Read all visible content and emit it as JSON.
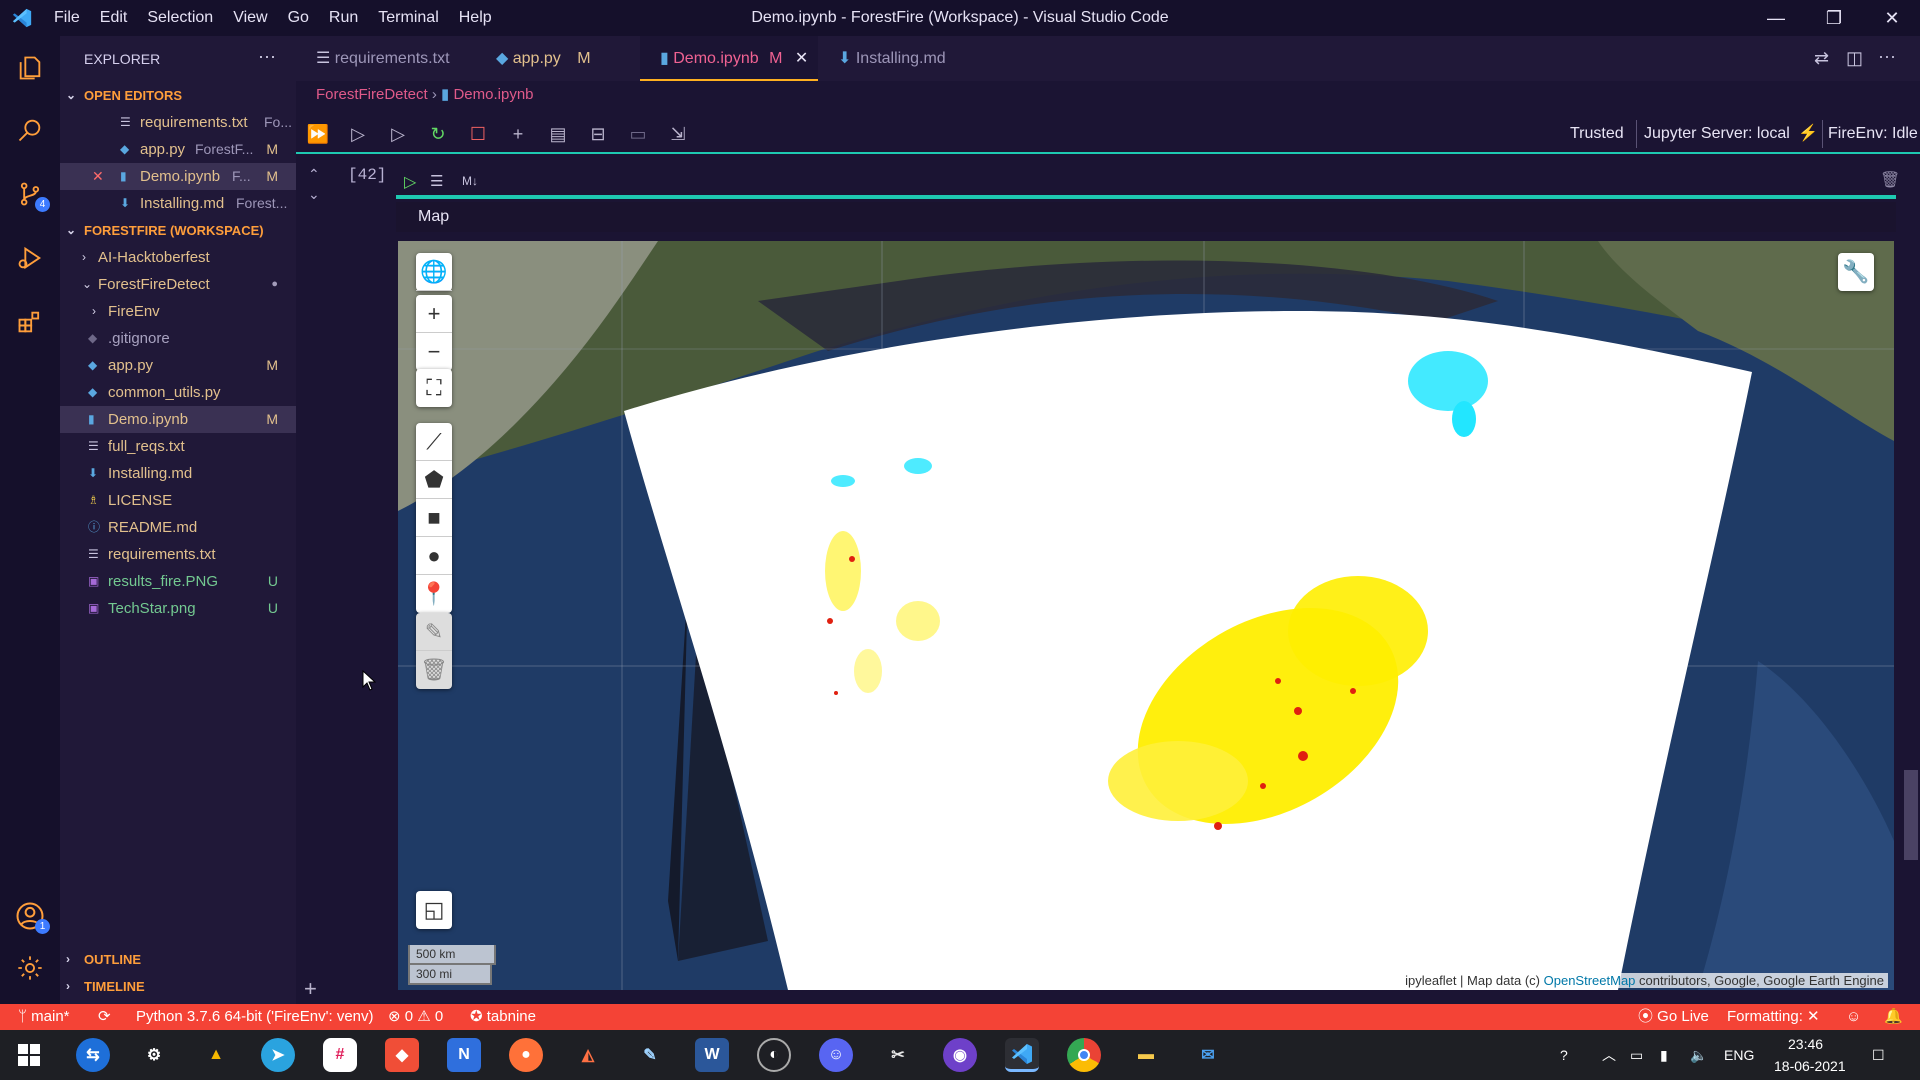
{
  "app": {
    "window_title": "Demo.ipynb - ForestFire (Workspace) - Visual Studio Code",
    "menu": [
      "File",
      "Edit",
      "Selection",
      "View",
      "Go",
      "Run",
      "Terminal",
      "Help"
    ]
  },
  "activity_bar": {
    "icons": [
      "files-icon",
      "search-icon",
      "source-control-icon",
      "run-debug-icon",
      "extensions-icon",
      "account-icon",
      "settings-gear-icon"
    ],
    "scm_badge": "4",
    "account_badge": "1"
  },
  "sidebar": {
    "title": "EXPLORER",
    "open_editors_title": "OPEN EDITORS",
    "open_editors": [
      {
        "name": "requirements.txt",
        "desc": "Fo...",
        "status": ""
      },
      {
        "name": "app.py",
        "desc": "ForestF...",
        "status": "M"
      },
      {
        "name": "Demo.ipynb",
        "desc": "F...",
        "status": "M"
      },
      {
        "name": "Installing.md",
        "desc": "Forest...",
        "status": ""
      }
    ],
    "workspace_title": "FORESTFIRE (WORKSPACE)",
    "tree": [
      {
        "name": "AI-Hacktoberfest",
        "status": ""
      },
      {
        "name": "ForestFireDetect",
        "status": "●"
      },
      {
        "name": "FireEnv",
        "status": ""
      },
      {
        "name": ".gitignore",
        "status": ""
      },
      {
        "name": "app.py",
        "status": "M"
      },
      {
        "name": "common_utils.py",
        "status": ""
      },
      {
        "name": "Demo.ipynb",
        "status": "M"
      },
      {
        "name": "full_reqs.txt",
        "status": ""
      },
      {
        "name": "Installing.md",
        "status": ""
      },
      {
        "name": "LICENSE",
        "status": ""
      },
      {
        "name": "README.md",
        "status": ""
      },
      {
        "name": "requirements.txt",
        "status": ""
      },
      {
        "name": "results_fire.PNG",
        "status": "U"
      },
      {
        "name": "TechStar.png",
        "status": "U"
      }
    ],
    "outline_title": "OUTLINE",
    "timeline_title": "TIMELINE"
  },
  "tabs": [
    {
      "name": "requirements.txt",
      "status": ""
    },
    {
      "name": "app.py",
      "status": "M"
    },
    {
      "name": "Demo.ipynb",
      "status": "M"
    },
    {
      "name": "Installing.md",
      "status": ""
    }
  ],
  "breadcrumb": {
    "folder": "ForestFireDetect",
    "file": "Demo.ipynb"
  },
  "notebook": {
    "trusted": "Trusted",
    "server": "Jupyter Server: local",
    "kernel": "FireEnv: Idle",
    "execution_count": "[42]",
    "cell_type": "M↓",
    "output_label": "Map"
  },
  "map": {
    "scale_km": "500 km",
    "scale_mi": "300 mi",
    "attribution_prefix": "ipyleaflet | Map data (c) ",
    "attribution_link": "OpenStreetMap",
    "attribution_suffix": " contributors, Google, Google Earth Engine"
  },
  "statusbar": {
    "branch": "main*",
    "python": "Python 3.7.6 64-bit ('FireEnv': venv)",
    "errors": "0",
    "warnings": "0",
    "tabnine": "tabnine",
    "golive": "Go Live",
    "formatting": "Formatting: ✕"
  },
  "taskbar": {
    "lang": "ENG",
    "time": "23:46",
    "date": "18-06-2021"
  },
  "colors": {
    "accent": "#f44336",
    "tab_active": "#f06292",
    "section": "#ff9e3b",
    "modified": "#e2c08d",
    "untracked": "#73c991",
    "teal": "#1ec9b1"
  }
}
